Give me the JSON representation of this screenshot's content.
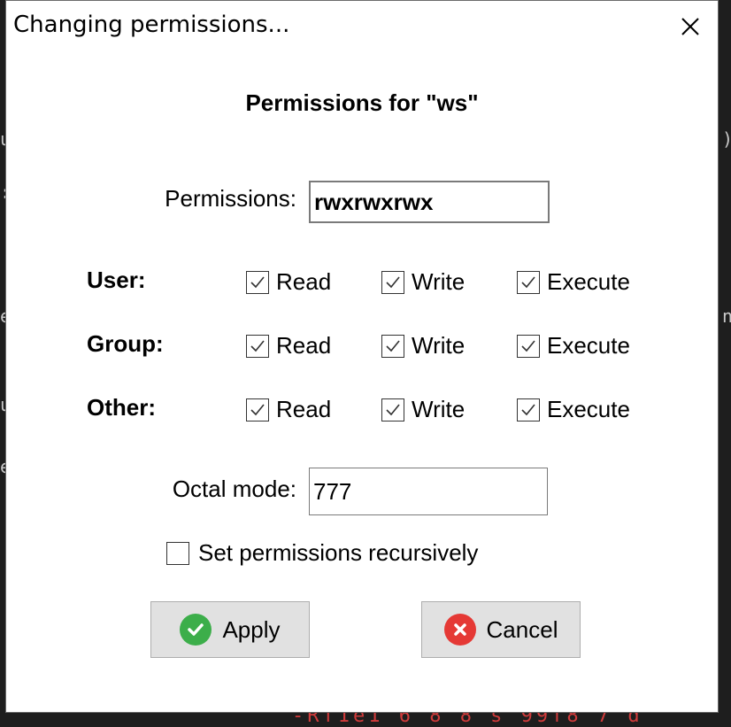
{
  "window": {
    "title": "Changing permissions..."
  },
  "dialog": {
    "heading": "Permissions for \"ws\"",
    "permissions_label": "Permissions:",
    "permissions_value": "rwxrwxrwx",
    "rows": [
      {
        "label": "User:",
        "read": "Read",
        "write": "Write",
        "execute": "Execute"
      },
      {
        "label": "Group:",
        "read": "Read",
        "write": "Write",
        "execute": "Execute"
      },
      {
        "label": "Other:",
        "read": "Read",
        "write": "Write",
        "execute": "Execute"
      }
    ],
    "checked": {
      "user": {
        "read": true,
        "write": true,
        "execute": true
      },
      "group": {
        "read": true,
        "write": true,
        "execute": true
      },
      "other": {
        "read": true,
        "write": true,
        "execute": true
      }
    },
    "octal_label": "Octal mode:",
    "octal_value": "777",
    "recursive_label": "Set permissions recursively",
    "recursive_checked": false,
    "apply_label": "Apply",
    "cancel_label": "Cancel"
  },
  "icons": {
    "close": "close-icon",
    "apply": "check-circle-icon",
    "cancel": "x-circle-icon"
  },
  "colors": {
    "apply_icon": "#3cae4a",
    "cancel_icon": "#e53935",
    "button_bg": "#e1e1e1"
  }
}
